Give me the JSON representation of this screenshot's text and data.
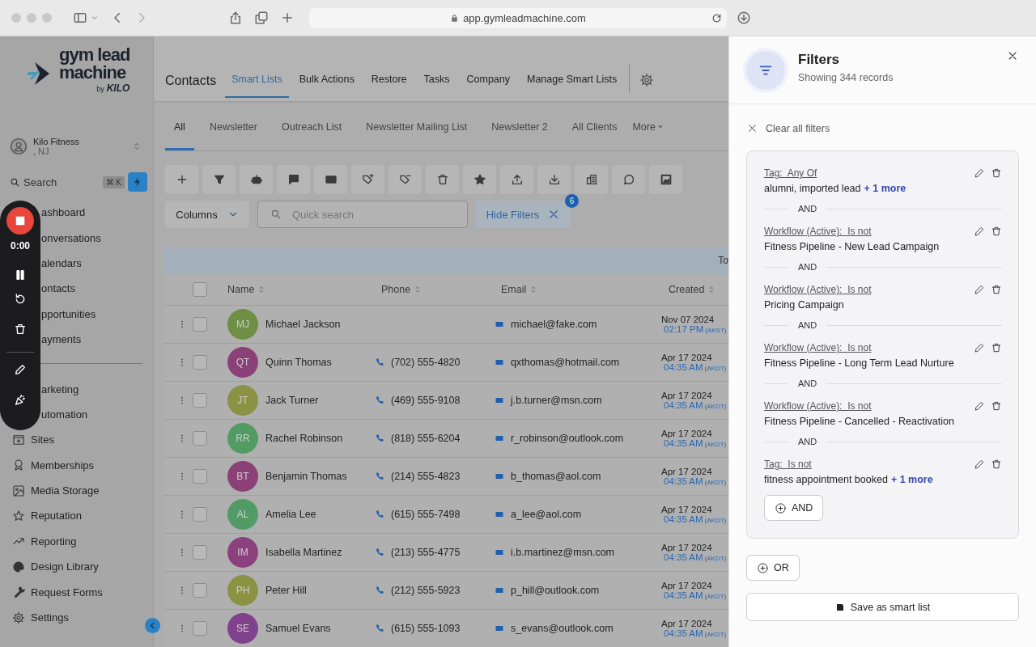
{
  "browser": {
    "address": "app.gymleadmachine.com"
  },
  "logo": {
    "line_1": "gym lead",
    "line_2": "machine",
    "byline": "by",
    "brand": "KILO"
  },
  "account": {
    "name": "Kilo Fitness",
    "location": ", NJ"
  },
  "sidebar_search": {
    "label": "Search",
    "shortcut": "⌘ K"
  },
  "sidebar": {
    "groups": [
      [
        {
          "label": "ashboard",
          "kind": "covered"
        },
        {
          "label": "onversations",
          "kind": "covered"
        },
        {
          "label": "alendars",
          "kind": "covered"
        },
        {
          "label": "ontacts",
          "kind": "covered"
        },
        {
          "label": "pportunities",
          "kind": "covered"
        },
        {
          "label": "ayments",
          "kind": "covered"
        }
      ],
      [
        {
          "label": "arketing",
          "kind": "covered"
        },
        {
          "label": "utomation",
          "kind": "covered"
        },
        {
          "label": "Sites",
          "kind": "plain"
        },
        {
          "label": "Memberships",
          "kind": "plain"
        },
        {
          "label": "Media Storage",
          "kind": "plain"
        },
        {
          "label": "Reputation",
          "kind": "plain"
        },
        {
          "label": "Reporting",
          "kind": "plain"
        },
        {
          "label": "Design Library",
          "kind": "plain"
        },
        {
          "label": "Request Forms",
          "kind": "plain"
        },
        {
          "label": "Settings",
          "kind": "plain"
        }
      ]
    ]
  },
  "recorder": {
    "time": "0:00"
  },
  "page_title": "Contacts",
  "tabs": [
    {
      "label": "Smart Lists",
      "selected": true
    },
    {
      "label": "Bulk Actions",
      "selected": false
    },
    {
      "label": "Restore",
      "selected": false
    },
    {
      "label": "Tasks",
      "selected": false
    },
    {
      "label": "Company",
      "selected": false
    },
    {
      "label": "Manage Smart Lists",
      "selected": false
    }
  ],
  "list_tabs": [
    {
      "label": "All",
      "selected": true
    },
    {
      "label": "Newsletter",
      "selected": false
    },
    {
      "label": "Outreach List",
      "selected": false
    },
    {
      "label": "Newsletter Mailing List",
      "selected": false
    },
    {
      "label": "Newsletter 2",
      "selected": false
    },
    {
      "label": "All Clients",
      "selected": false
    }
  ],
  "more_tab": "More",
  "columns_button": "Columns",
  "search": {
    "placeholder": "Quick search"
  },
  "hide_filters": {
    "label": "Hide Filters",
    "count": "6"
  },
  "table": {
    "banner": "To",
    "all_selected": false,
    "columns": [
      "Name",
      "Phone",
      "Email",
      "Created"
    ],
    "rows": [
      {
        "initials": "MJ",
        "color": "#6f8f45",
        "name": "Michael Jackson",
        "email": "michael@fake.com",
        "date": "Nov 07 2024",
        "time": "02:17 PM",
        "zone": "(AKST)",
        "checked": false
      },
      {
        "initials": "QT",
        "color": "#8b4178",
        "name": "Quinn Thomas",
        "phone": "(702) 555-4820",
        "email": "qxthomas@hotmail.com",
        "date": "Apr 17 2024",
        "time": "04:35 AM",
        "zone": "(AKDT)",
        "checked": false
      },
      {
        "initials": "JT",
        "color": "#8c9244",
        "name": "Jack Turner",
        "phone": "(469) 555-9108",
        "email": "j.b.turner@msn.com",
        "date": "Apr 17 2024",
        "time": "04:35 AM",
        "zone": "(AKDT)",
        "checked": false
      },
      {
        "initials": "RR",
        "color": "#529b62",
        "name": "Rachel Robinson",
        "phone": "(818) 555-6204",
        "email": "r_robinson@outlook.com",
        "date": "Apr 17 2024",
        "time": "04:35 AM",
        "zone": "(AKDT)",
        "checked": false
      },
      {
        "initials": "BT",
        "color": "#8b4176",
        "name": "Benjamin Thomas",
        "phone": "(214) 555-4823",
        "email": "b_thomas@aol.com",
        "date": "Apr 17 2024",
        "time": "04:35 AM",
        "zone": "(AKDT)",
        "checked": false
      },
      {
        "initials": "AL",
        "color": "#529b66",
        "name": "Amelia Lee",
        "phone": "(615) 555-7498",
        "email": "a_lee@aol.com",
        "date": "Apr 17 2024",
        "time": "04:35 AM",
        "zone": "(AKDT)",
        "checked": false
      },
      {
        "initials": "IM",
        "color": "#8b417e",
        "name": "Isabella Martinez",
        "phone": "(213) 555-4775",
        "email": "i.b.martinez@msn.com",
        "date": "Apr 17 2024",
        "time": "04:35 AM",
        "zone": "(AKDT)",
        "checked": false
      },
      {
        "initials": "PH",
        "color": "#8c9244",
        "name": "Peter Hill",
        "phone": "(212) 555-5923",
        "email": "p_hill@outlook.com",
        "date": "Apr 17 2024",
        "time": "04:35 AM",
        "zone": "(AKDT)",
        "checked": false
      },
      {
        "initials": "SE",
        "color": "#80428c",
        "name": "Samuel Evans",
        "phone": "(615) 555-1093",
        "email": "s_evans@outlook.com",
        "date": "Apr 17 2024",
        "time": "04:35 AM",
        "zone": "(AKDT)",
        "checked": false
      }
    ]
  },
  "filters_panel": {
    "title": "Filters",
    "subtitle": "Showing 344 records",
    "clear": "Clear all filters",
    "filters": [
      {
        "field": "Tag:  Any Of",
        "value": "alumni, imported lead",
        "more": "+ 1 more"
      },
      {
        "connector": "AND",
        "field": "Workflow (Active):  Is not",
        "value": "Fitness Pipeline - New Lead Campaign"
      },
      {
        "connector": "AND",
        "field": "Workflow (Active):  Is not",
        "value": "Pricing Campaign"
      },
      {
        "connector": "AND",
        "field": "Workflow (Active):  Is not",
        "value": "Fitness Pipeline - Long Term Lead Nurture"
      },
      {
        "connector": "AND",
        "field": "Workflow (Active):  Is not",
        "value": "Fitness Pipeline - Cancelled - Reactivation"
      },
      {
        "connector": "AND",
        "field": "Tag:  Is not",
        "value": "fitness appointment booked",
        "more": "+ 1 more"
      }
    ],
    "and_button": "AND",
    "or_button": "OR",
    "save_button": "Save as smart list"
  }
}
